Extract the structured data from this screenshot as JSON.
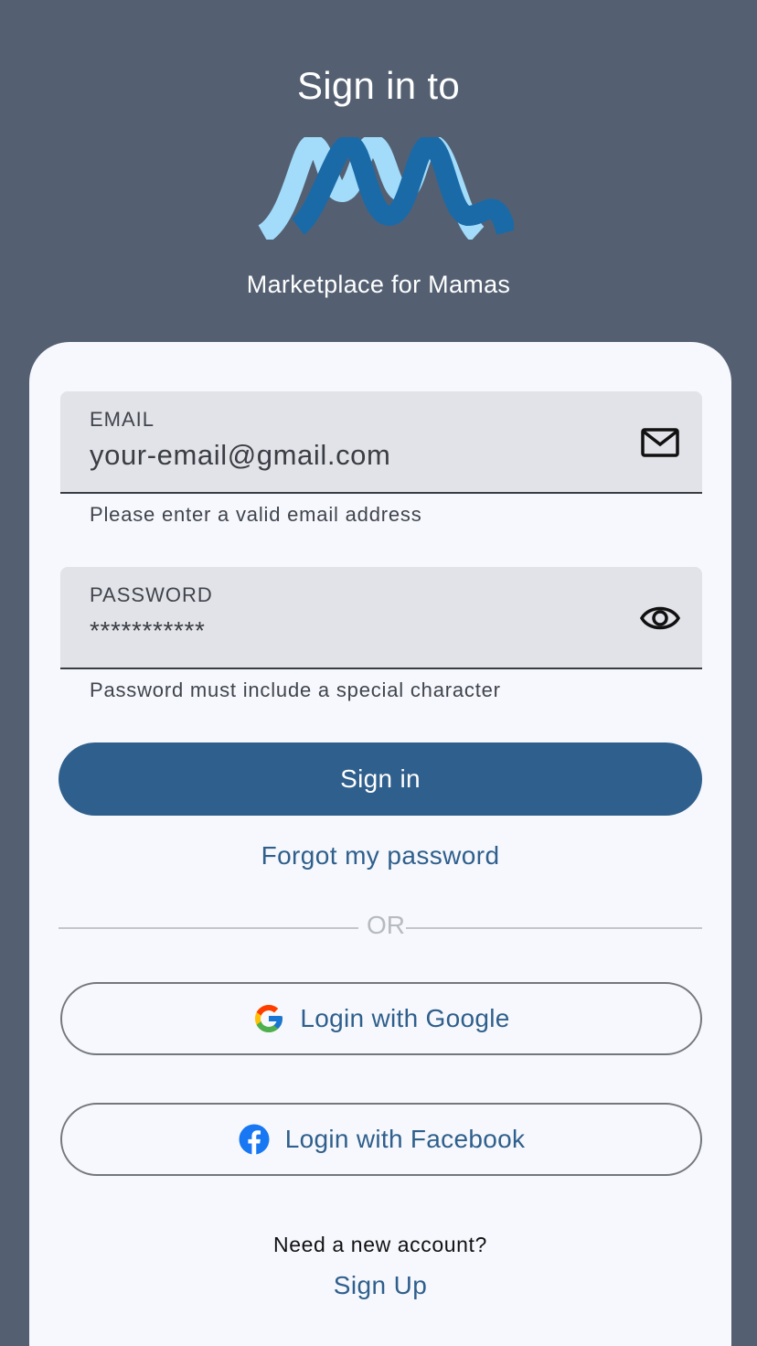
{
  "header": {
    "title": "Sign in to",
    "app_name": "Marketplace for Mamas",
    "logo_icon": "mm-wave-logo",
    "logo_colors": {
      "light": "#a3dcfa",
      "dark": "#1a6aa8"
    }
  },
  "form": {
    "email": {
      "label": "EMAIL",
      "value": "your-email@gmail.com",
      "icon": "mail-icon",
      "helper": "Please enter a valid email address"
    },
    "password": {
      "label": "PASSWORD",
      "value": "***********",
      "icon": "eye-icon",
      "helper": "Password must include a special character"
    },
    "sign_in_label": "Sign in",
    "forgot_label": "Forgot my password"
  },
  "divider": {
    "label": "OR"
  },
  "social": {
    "google_label": "Login with Google",
    "google_icon": "google-icon",
    "facebook_label": "Login with Facebook",
    "facebook_icon": "facebook-icon"
  },
  "footer": {
    "prompt": "Need a new account?",
    "signup_label": "Sign Up"
  },
  "colors": {
    "background": "#546072",
    "card": "#f6f8fd",
    "accent": "#2f5f8c",
    "field": "#e2e3e8"
  }
}
